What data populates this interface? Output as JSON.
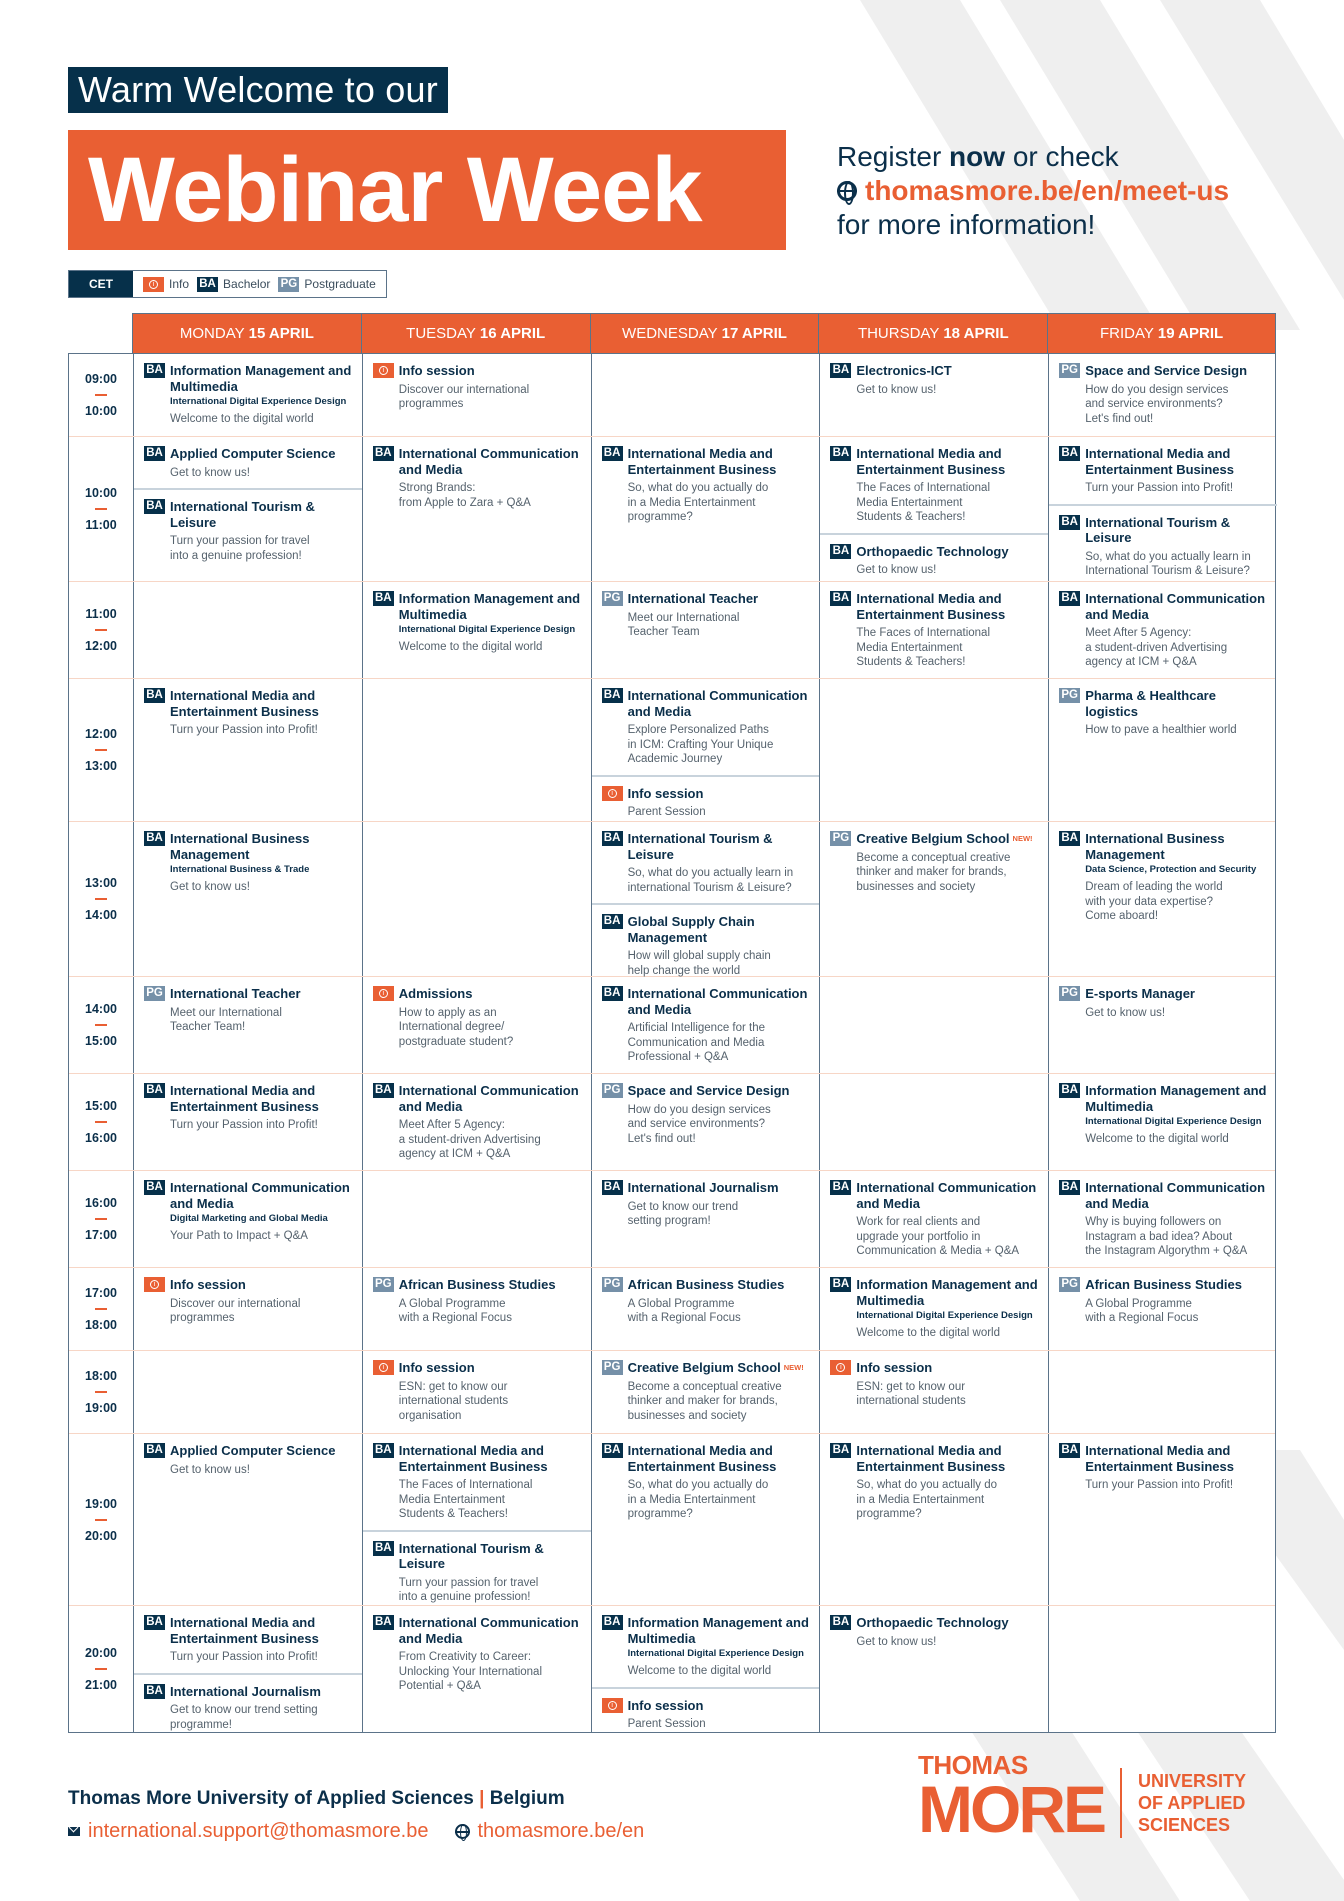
{
  "header": {
    "welcome": "Warm Welcome to our",
    "title": "Webinar Week",
    "register_prefix": "Register ",
    "register_bold": "now",
    "register_suffix": " or check",
    "url": "thomasmore.be/en/meet-us",
    "more_info": "for more information!"
  },
  "legend": {
    "timezone": "CET",
    "items": [
      {
        "type": "info",
        "label": "Info"
      },
      {
        "type": "ba",
        "badge": "BA",
        "label": "Bachelor"
      },
      {
        "type": "pg",
        "badge": "PG",
        "label": "Postgraduate"
      }
    ]
  },
  "badges": {
    "ba": "BA",
    "pg": "PG",
    "info": "i",
    "new": "NEW!"
  },
  "days": [
    {
      "weekday": "MONDAY",
      "date": "15 APRIL"
    },
    {
      "weekday": "TUESDAY",
      "date": "16 APRIL"
    },
    {
      "weekday": "WEDNESDAY",
      "date": "17 APRIL"
    },
    {
      "weekday": "THURSDAY",
      "date": "18 APRIL"
    },
    {
      "weekday": "FRIDAY",
      "date": "19 APRIL"
    }
  ],
  "slots": [
    {
      "start": "09:00",
      "end": "10:00",
      "cells": [
        [
          {
            "type": "ba",
            "title": "Information Management and Multimedia",
            "sub": "International Digital Experience Design",
            "desc": "Welcome to the digital world"
          }
        ],
        [
          {
            "type": "info",
            "title": "Info session",
            "desc": "Discover our international\nprogrammes"
          }
        ],
        [],
        [
          {
            "type": "ba",
            "title": "Electronics-ICT",
            "desc": "Get to know us!"
          }
        ],
        [
          {
            "type": "pg",
            "title": "Space and Service Design",
            "desc": "How do you design services\nand service environments?\nLet's find out!"
          }
        ]
      ]
    },
    {
      "start": "10:00",
      "end": "11:00",
      "cells": [
        [
          {
            "type": "ba",
            "title": "Applied Computer Science",
            "desc": "Get to know us!"
          },
          {
            "type": "ba",
            "title": "International Tourism & Leisure",
            "desc": "Turn your passion for travel\ninto a genuine profession!"
          }
        ],
        [
          {
            "type": "ba",
            "title": "International Communication and Media",
            "desc": "Strong Brands:\nfrom Apple  to Zara + Q&A"
          }
        ],
        [
          {
            "type": "ba",
            "title": "International Media and Entertainment Business",
            "desc": "So, what do you actually do\nin a Media Entertainment\nprogramme?"
          }
        ],
        [
          {
            "type": "ba",
            "title": "International Media and Entertainment Business",
            "desc": "The Faces of International\nMedia Entertainment\nStudents & Teachers!"
          },
          {
            "type": "ba",
            "title": "Orthopaedic Technology",
            "desc": "Get to know us!"
          }
        ],
        [
          {
            "type": "ba",
            "title": "International Media and Entertainment Business",
            "desc": "Turn your Passion into Profit!"
          },
          {
            "type": "ba",
            "title": "International Tourism & Leisure",
            "desc": "So, what do you actually learn in\nInternational Tourism & Leisure?"
          }
        ]
      ]
    },
    {
      "start": "11:00",
      "end": "12:00",
      "cells": [
        [],
        [
          {
            "type": "ba",
            "title": "Information Management and Multimedia",
            "sub": "International Digital Experience Design",
            "desc": "Welcome to the digital world"
          }
        ],
        [
          {
            "type": "pg",
            "title": "International Teacher",
            "desc": "Meet our International\nTeacher Team"
          }
        ],
        [
          {
            "type": "ba",
            "title": "International Media and Entertainment Business",
            "desc": "The Faces of International\nMedia Entertainment\nStudents & Teachers!"
          }
        ],
        [
          {
            "type": "ba",
            "title": "International Communication and Media",
            "desc": "Meet After 5 Agency:\na student-driven Advertising\nagency at ICM + Q&A"
          }
        ]
      ]
    },
    {
      "start": "12:00",
      "end": "13:00",
      "cells": [
        [
          {
            "type": "ba",
            "title": "International Media and Entertainment Business",
            "desc": "Turn your Passion into Profit!"
          }
        ],
        [],
        [
          {
            "type": "ba",
            "title": "International Communication and Media",
            "desc": "Explore Personalized Paths\nin ICM: Crafting Your Unique\nAcademic Journey"
          },
          {
            "type": "info",
            "title": "Info session",
            "desc": "Parent Session"
          }
        ],
        [],
        [
          {
            "type": "pg",
            "title": "Pharma & Healthcare logistics",
            "desc": "How to pave a healthier world"
          }
        ]
      ]
    },
    {
      "start": "13:00",
      "end": "14:00",
      "cells": [
        [
          {
            "type": "ba",
            "title": "International Business Management",
            "sub": "International Business & Trade",
            "desc": "Get to know us!"
          }
        ],
        [],
        [
          {
            "type": "ba",
            "title": "International Tourism & Leisure",
            "desc": "So, what do you actually learn in\ninternational Tourism & Leisure?"
          },
          {
            "type": "ba",
            "title": "Global Supply Chain Management",
            "desc": "How will global supply chain\nhelp change the world"
          }
        ],
        [
          {
            "type": "pg",
            "title": "Creative Belgium School",
            "new": true,
            "desc": "Become a conceptual creative\nthinker and maker for brands,\nbusinesses and society"
          }
        ],
        [
          {
            "type": "ba",
            "title": "International Business Management",
            "sub": "Data Science, Protection and Security",
            "desc": "Dream of leading the world\nwith your data expertise?\nCome aboard!"
          }
        ]
      ]
    },
    {
      "start": "14:00",
      "end": "15:00",
      "cells": [
        [
          {
            "type": "pg",
            "title": "International Teacher",
            "desc": "Meet our International\nTeacher Team!"
          }
        ],
        [
          {
            "type": "info",
            "title": "Admissions",
            "desc": "How to apply as an\nInternational degree/\npostgraduate student?"
          }
        ],
        [
          {
            "type": "ba",
            "title": "International Communication and Media",
            "desc": "Artificial Intelligence for the\nCommunication and Media\nProfessional + Q&A"
          }
        ],
        [],
        [
          {
            "type": "pg",
            "title": "E-sports Manager",
            "desc": "Get to know us!"
          }
        ]
      ]
    },
    {
      "start": "15:00",
      "end": "16:00",
      "cells": [
        [
          {
            "type": "ba",
            "title": "International Media and Entertainment Business",
            "desc": "Turn your Passion into Profit!"
          }
        ],
        [
          {
            "type": "ba",
            "title": "International Communication and Media",
            "desc": "Meet After 5 Agency:\na student-driven Advertising\nagency at ICM + Q&A"
          }
        ],
        [
          {
            "type": "pg",
            "title": "Space and Service Design",
            "desc": "How do you design services\nand service environments?\nLet's find out!"
          }
        ],
        [],
        [
          {
            "type": "ba",
            "title": "Information Management and Multimedia",
            "sub": "International Digital Experience Design",
            "desc": "Welcome to the digital world"
          }
        ]
      ]
    },
    {
      "start": "16:00",
      "end": "17:00",
      "cells": [
        [
          {
            "type": "ba",
            "title": "International Communication and Media",
            "sub": "Digital Marketing and Global Media",
            "desc": "Your Path to Impact + Q&A"
          }
        ],
        [],
        [
          {
            "type": "ba",
            "title": "International Journalism",
            "desc": "Get to know our trend\nsetting program!"
          }
        ],
        [
          {
            "type": "ba",
            "title": "International Communication and Media",
            "desc": "Work for real clients and\nupgrade your portfolio in\nCommunication & Media + Q&A"
          }
        ],
        [
          {
            "type": "ba",
            "title": "International Communication and Media",
            "desc": "Why is buying followers on\nInstagram a bad idea? About\nthe Instagram Algorythm + Q&A"
          }
        ]
      ]
    },
    {
      "start": "17:00",
      "end": "18:00",
      "cells": [
        [
          {
            "type": "info",
            "title": "Info session",
            "desc": "Discover our international\nprogrammes"
          }
        ],
        [
          {
            "type": "pg",
            "title": "African Business Studies",
            "desc": "A Global Programme\nwith a Regional Focus"
          }
        ],
        [
          {
            "type": "pg",
            "title": "African Business Studies",
            "desc": "A Global Programme\nwith a Regional Focus"
          }
        ],
        [
          {
            "type": "ba",
            "title": "Information Management and Multimedia",
            "sub": "International Digital Experience Design",
            "desc": "Welcome to the digital world"
          }
        ],
        [
          {
            "type": "pg",
            "title": "African Business Studies",
            "desc": "A Global Programme\nwith a Regional Focus"
          }
        ]
      ]
    },
    {
      "start": "18:00",
      "end": "19:00",
      "cells": [
        [],
        [
          {
            "type": "info",
            "title": "Info session",
            "desc": "ESN: get to know our\ninternational students\norganisation"
          }
        ],
        [
          {
            "type": "pg",
            "title": "Creative Belgium School",
            "new": true,
            "desc": "Become a conceptual creative\nthinker and maker for brands,\nbusinesses and society"
          }
        ],
        [
          {
            "type": "info",
            "title": "Info session",
            "desc": "ESN: get to know our\ninternational students"
          }
        ],
        []
      ]
    },
    {
      "start": "19:00",
      "end": "20:00",
      "cells": [
        [
          {
            "type": "ba",
            "title": "Applied Computer Science",
            "desc": "Get to know us!"
          }
        ],
        [
          {
            "type": "ba",
            "title": "International Media and Entertainment Business",
            "desc": "The Faces of International\nMedia Entertainment\nStudents & Teachers!"
          },
          {
            "type": "ba",
            "title": "International Tourism & Leisure",
            "desc": "Turn your passion for travel\ninto a genuine profession!"
          }
        ],
        [
          {
            "type": "ba",
            "title": "International Media and Entertainment Business",
            "desc": "So, what do you actually do\nin a Media Entertainment\nprogramme?"
          }
        ],
        [
          {
            "type": "ba",
            "title": "International Media and Entertainment Business",
            "desc": "So, what do you actually do\nin a Media Entertainment\nprogramme?"
          }
        ],
        [
          {
            "type": "ba",
            "title": "International Media and Entertainment Business",
            "desc": "Turn your Passion into Profit!"
          }
        ]
      ]
    },
    {
      "start": "20:00",
      "end": "21:00",
      "cells": [
        [
          {
            "type": "ba",
            "title": "International Media and Entertainment Business",
            "desc": "Turn your Passion into Profit!"
          },
          {
            "type": "ba",
            "title": "International Journalism",
            "desc": "Get to know our trend setting\nprogramme!"
          }
        ],
        [
          {
            "type": "ba",
            "title": "International Communication and Media",
            "desc": "From Creativity to Career:\nUnlocking Your International\nPotential + Q&A"
          }
        ],
        [
          {
            "type": "ba",
            "title": "Information Management and Multimedia",
            "sub": "International Digital Experience Design",
            "desc": "Welcome to the digital world"
          },
          {
            "type": "info",
            "title": "Info session",
            "desc": "Parent Session"
          }
        ],
        [
          {
            "type": "ba",
            "title": "Orthopaedic Technology",
            "desc": "Get to know us!"
          }
        ],
        []
      ]
    }
  ],
  "footer": {
    "org": "Thomas More University of Applied Sciences",
    "separator": "|",
    "country": "Belgium",
    "email": "international.support@thomasmore.be",
    "website": "thomasmore.be/en"
  },
  "logo": {
    "line1": "THOMAS",
    "line2": "MORE",
    "tag1": "UNIVERSITY",
    "tag2": "OF APPLIED",
    "tag3": "SCIENCES"
  },
  "colors": {
    "orange": "#e95f33",
    "navy": "#06304a",
    "pg": "#7590a8"
  }
}
